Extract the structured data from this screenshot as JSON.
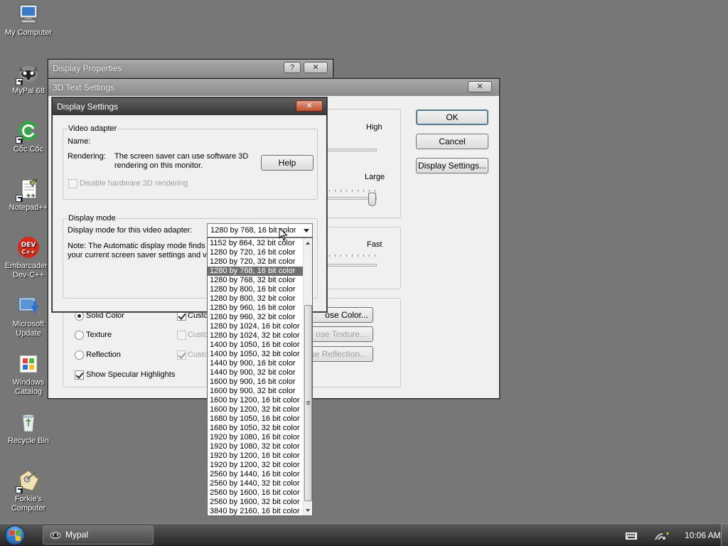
{
  "desktop": {
    "icons": [
      {
        "label": "My Computer",
        "icon": "my-computer-icon"
      },
      {
        "label": "MyPal 68",
        "icon": "mypal-raccoon-icon"
      },
      {
        "label": "Cốc Cốc",
        "icon": "coccoc-icon"
      },
      {
        "label": "Notepad++",
        "icon": "notepad-plus-plus-icon"
      },
      {
        "label": "Embarcadero Dev-C++",
        "icon": "dev-cpp-icon"
      },
      {
        "label": "Microsoft Update",
        "icon": "microsoft-update-icon"
      },
      {
        "label": "Windows Catalog",
        "icon": "windows-catalog-icon"
      },
      {
        "label": "Recycle Bin",
        "icon": "recycle-bin-icon"
      },
      {
        "label": "Forkie's Computer",
        "icon": "forkie-computer-icon"
      }
    ]
  },
  "display_properties": {
    "title": "Display Properties",
    "help_btn": "?",
    "close_btn": "✕"
  },
  "text3d": {
    "title": "3D Text Settings",
    "close_btn": "✕",
    "ok": "OK",
    "cancel": "Cancel",
    "display_settings": "Display Settings...",
    "resolution_high": "High",
    "size_large": "Large",
    "speed_fast": "Fast",
    "surface": {
      "solid_color": "Solid Color",
      "texture": "Texture",
      "reflection": "Reflection",
      "specular": "Show Specular Highlights",
      "custom_color_partial": "Custo",
      "custom_texture_partial": "Custo",
      "custom_reflection_partial": "Custo",
      "choose_color_partial": "ose Color...",
      "choose_texture_partial": "ose Texture...",
      "choose_reflection_partial": "se Reflection..."
    },
    "colors": {
      "accent": "#707070",
      "dialog_bg": "#f0f0f0"
    }
  },
  "display_settings": {
    "title": "Display Settings",
    "close_btn": "✕",
    "video_adapter": {
      "group_label": "Video adapter",
      "name_label": "Name:",
      "rendering_label": "Rendering:",
      "rendering_line1": "The screen saver can use software 3D",
      "rendering_line2": "rendering on this monitor.",
      "help": "Help",
      "disable_hw": "Disable hardware 3D rendering"
    },
    "display_mode": {
      "group_label": "Display mode",
      "label": "Display mode for this video adapter:",
      "selected": "1280 by 768, 16 bit color",
      "note_line1": "Note: The Automatic display mode finds a",
      "note_line2": "your current screen saver settings and vid",
      "options": [
        "1152 by 864, 32 bit color",
        "1280 by 720, 16 bit color",
        "1280 by 720, 32 bit color",
        "1280 by 768, 16 bit color",
        "1280 by 768, 32 bit color",
        "1280 by 800, 16 bit color",
        "1280 by 800, 32 bit color",
        "1280 by 960, 16 bit color",
        "1280 by 960, 32 bit color",
        "1280 by 1024, 16 bit color",
        "1280 by 1024, 32 bit color",
        "1400 by 1050, 16 bit color",
        "1400 by 1050, 32 bit color",
        "1440 by 900, 16 bit color",
        "1440 by 900, 32 bit color",
        "1600 by 900, 16 bit color",
        "1600 by 900, 32 bit color",
        "1600 by 1200, 16 bit color",
        "1600 by 1200, 32 bit color",
        "1680 by 1050, 16 bit color",
        "1680 by 1050, 32 bit color",
        "1920 by 1080, 16 bit color",
        "1920 by 1080, 32 bit color",
        "1920 by 1200, 16 bit color",
        "1920 by 1200, 32 bit color",
        "2560 by 1440, 16 bit color",
        "2560 by 1440, 32 bit color",
        "2560 by 1600, 16 bit color",
        "2560 by 1600, 32 bit color",
        "3840 by 2160, 16 bit color"
      ],
      "selected_index": 3
    }
  },
  "taskbar": {
    "task_label": "Mypal",
    "clock": "10:06 AM",
    "tray_icons": [
      "keyboard-icon",
      "network-icon"
    ]
  }
}
